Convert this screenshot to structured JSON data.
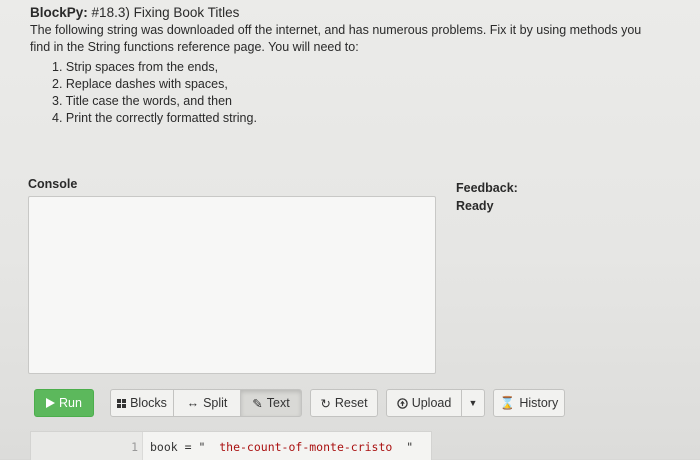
{
  "header": {
    "brand": "BlockPy:",
    "assignment": "#18.3) Fixing Book Titles"
  },
  "instructions": {
    "description": "The following string was downloaded off the internet, and has numerous problems. Fix it by using methods you find in the String functions reference page. You will need to:",
    "steps": [
      "1. Strip spaces from the ends,",
      "2. Replace dashes with spaces,",
      "3. Title case the words, and then",
      "4. Print the correctly formatted string."
    ]
  },
  "console": {
    "label": "Console"
  },
  "feedback": {
    "label": "Feedback:",
    "status": "Ready"
  },
  "toolbar": {
    "run": "Run",
    "blocks": "Blocks",
    "split": "Split",
    "text": "Text",
    "reset": "Reset",
    "upload": "Upload",
    "history": "History",
    "icons": {
      "run": "play-icon",
      "blocks": "blocks-grid-icon",
      "split": "split-arrows-icon",
      "text": "pencil-icon",
      "reset": "refresh-icon",
      "upload": "upload-circle-icon",
      "upload_caret": "caret-down-icon",
      "history": "hourglass-icon"
    },
    "colors": {
      "run": "#5cb85c"
    }
  },
  "editor": {
    "line_number": "1",
    "code_prefix": "book = \"",
    "code_string": "  the-count-of-monte-cristo  ",
    "code_suffix": "\""
  }
}
